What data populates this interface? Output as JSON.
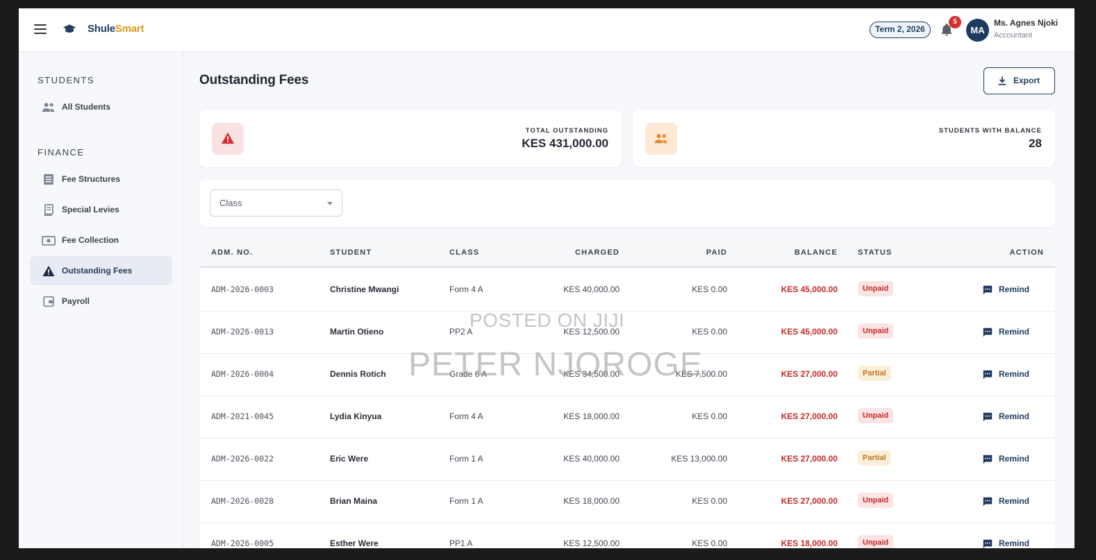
{
  "header": {
    "brand_part1": "Shule",
    "brand_part2": "Smart",
    "term": "Term 2, 2026",
    "notification_count": "5",
    "avatar_initials": "MA",
    "user_name": "Ms. Agnes Njoki",
    "user_role": "Accountant"
  },
  "sidebar": {
    "sections": [
      {
        "title": "STUDENTS",
        "items": [
          {
            "label": "All Students",
            "icon": "users-icon"
          }
        ]
      },
      {
        "title": "FINANCE",
        "items": [
          {
            "label": "Fee Structures",
            "icon": "list-icon"
          },
          {
            "label": "Special Levies",
            "icon": "receipt-icon"
          },
          {
            "label": "Fee Collection",
            "icon": "cash-icon"
          },
          {
            "label": "Outstanding Fees",
            "icon": "warning-icon",
            "active": true
          },
          {
            "label": "Payroll",
            "icon": "wallet-icon"
          }
        ]
      }
    ]
  },
  "main": {
    "title": "Outstanding Fees",
    "export_label": "Export",
    "stats": [
      {
        "label": "TOTAL OUTSTANDING",
        "value": "KES 431,000.00",
        "icon": "warning-icon",
        "color": "#d32f2f"
      },
      {
        "label": "STUDENTS WITH BALANCE",
        "value": "28",
        "icon": "users-icon",
        "color": "#e08a2c"
      }
    ],
    "filter": {
      "value": "Class"
    },
    "table": {
      "headers": [
        "ADM. NO.",
        "STUDENT",
        "CLASS",
        "CHARGED",
        "PAID",
        "BALANCE",
        "STATUS",
        "ACTION"
      ],
      "rows": [
        {
          "adm": "ADM-2026-0003",
          "student": "Christine Mwangi",
          "class": "Form 4 A",
          "charged": "KES 40,000.00",
          "paid": "KES 0.00",
          "balance": "KES 45,000.00",
          "status": "Unpaid",
          "action": "Remind"
        },
        {
          "adm": "ADM-2026-0013",
          "student": "Martin Otieno",
          "class": "PP2 A",
          "charged": "KES 12,500.00",
          "paid": "KES 0.00",
          "balance": "KES 45,000.00",
          "status": "Unpaid",
          "action": "Remind"
        },
        {
          "adm": "ADM-2026-0004",
          "student": "Dennis Rotich",
          "class": "Grade 6 A",
          "charged": "KES 34,500.00",
          "paid": "KES 7,500.00",
          "balance": "KES 27,000.00",
          "status": "Partial",
          "action": "Remind"
        },
        {
          "adm": "ADM-2021-0045",
          "student": "Lydia Kinyua",
          "class": "Form 4 A",
          "charged": "KES 18,000.00",
          "paid": "KES 0.00",
          "balance": "KES 27,000.00",
          "status": "Unpaid",
          "action": "Remind"
        },
        {
          "adm": "ADM-2026-0022",
          "student": "Eric Were",
          "class": "Form 1 A",
          "charged": "KES 40,000.00",
          "paid": "KES 13,000.00",
          "balance": "KES 27,000.00",
          "status": "Partial",
          "action": "Remind"
        },
        {
          "adm": "ADM-2026-0028",
          "student": "Brian Maina",
          "class": "Form 1 A",
          "charged": "KES 18,000.00",
          "paid": "KES 0.00",
          "balance": "KES 27,000.00",
          "status": "Unpaid",
          "action": "Remind"
        },
        {
          "adm": "ADM-2026-0005",
          "student": "Esther Were",
          "class": "PP1 A",
          "charged": "KES 12,500.00",
          "paid": "KES 0.00",
          "balance": "KES 18,000.00",
          "status": "Unpaid",
          "action": "Remind"
        }
      ]
    }
  },
  "watermark": {
    "line1": "POSTED ON JIJI",
    "line2": "PETER NJOROGE"
  }
}
